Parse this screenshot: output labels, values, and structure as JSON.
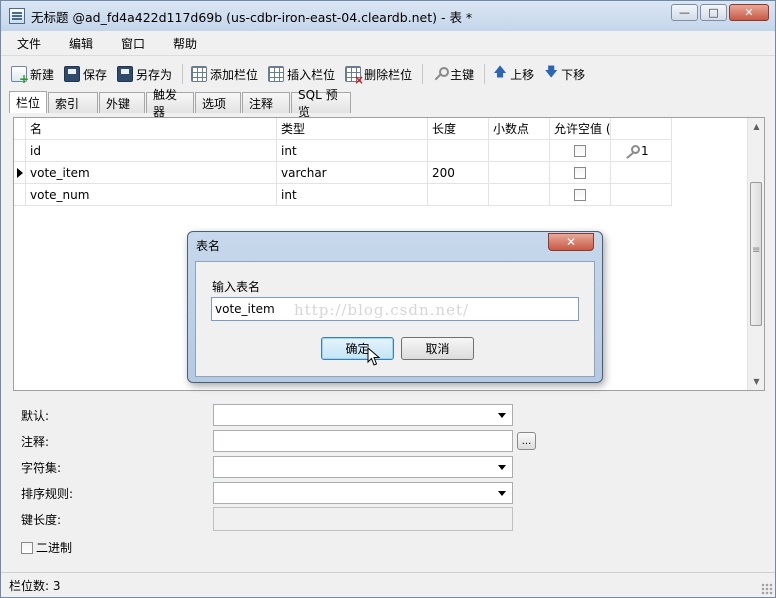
{
  "window": {
    "title": "无标题 @ad_fd4a422d117d69b (us-cdbr-iron-east-04.cleardb.net) - 表 *",
    "minimize_glyph": "—",
    "maximize_glyph": "□",
    "close_glyph": "✕"
  },
  "menu": [
    "文件",
    "编辑",
    "窗口",
    "帮助"
  ],
  "toolbar": {
    "new": "新建",
    "save": "保存",
    "save_as": "另存为",
    "add_field": "添加栏位",
    "insert_field": "插入栏位",
    "delete_field": "删除栏位",
    "primary_key": "主键",
    "move_up": "上移",
    "move_down": "下移"
  },
  "tabs": [
    "栏位",
    "索引",
    "外键",
    "触发器",
    "选项",
    "注释",
    "SQL 预览"
  ],
  "grid": {
    "headers": [
      "名",
      "类型",
      "长度",
      "小数点",
      "允许空值 (",
      ""
    ],
    "rows": [
      {
        "name": "id",
        "type": "int",
        "length": "",
        "decimals": "",
        "key_label": "1",
        "selected": false
      },
      {
        "name": "vote_item",
        "type": "varchar",
        "length": "200",
        "decimals": "",
        "key_label": "",
        "selected": true
      },
      {
        "name": "vote_num",
        "type": "int",
        "length": "",
        "decimals": "",
        "key_label": "",
        "selected": false
      }
    ]
  },
  "properties": {
    "default_label": "默认:",
    "comment_label": "注释:",
    "charset_label": "字符集:",
    "collation_label": "排序规则:",
    "key_length_label": "键长度:",
    "binary_label": "二进制",
    "ellipsis": "..."
  },
  "status": {
    "field_count": "栏位数: 3"
  },
  "dialog": {
    "title": "表名",
    "close_glyph": "✕",
    "prompt": "输入表名",
    "input_value": "vote_item",
    "watermark": "http://blog.csdn.net/",
    "ok": "确定",
    "cancel": "取消"
  }
}
